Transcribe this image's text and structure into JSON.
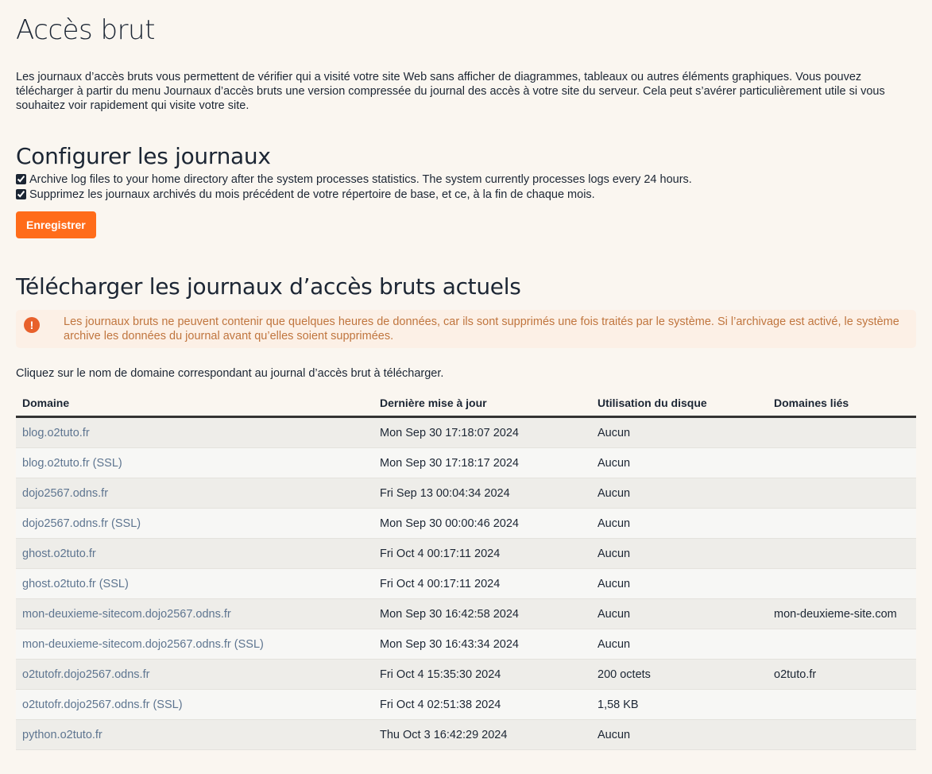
{
  "title": "Accès brut",
  "intro": "Les journaux d’accès bruts vous permettent de vérifier qui a visité votre site Web sans afficher de diagrammes, tableaux ou autres éléments graphiques. Vous pouvez télécharger à partir du menu Journaux d’accès bruts une version compressée du journal des accès à votre site du serveur. Cela peut s’avérer particulièrement utile si vous souhaitez voir rapidement qui visite votre site.",
  "config": {
    "heading": "Configurer les journaux",
    "archive_label": "Archive log files to your home directory after the system processes statistics. The system currently processes logs every 24 hours.",
    "delete_label": "Supprimez les journaux archivés du mois précédent de votre répertoire de base, et ce, à la fin de chaque mois.",
    "save_label": "Enregistrer"
  },
  "download": {
    "heading": "Télécharger les journaux d’accès bruts actuels",
    "alert": "Les journaux bruts ne peuvent contenir que quelques heures de données, car ils sont supprimés une fois traités par le système. Si l’archivage est activé, le système archive les données du journal avant qu’elles soient supprimées.",
    "hint": "Cliquez sur le nom de domaine correspondant au journal d’accès brut à télécharger.",
    "columns": [
      "Domaine",
      "Dernière mise à jour",
      "Utilisation du disque",
      "Domaines liés"
    ],
    "rows": [
      [
        "blog.o2tuto.fr",
        "Mon Sep 30 17:18:07 2024",
        "Aucun",
        ""
      ],
      [
        "blog.o2tuto.fr (SSL)",
        "Mon Sep 30 17:18:17 2024",
        "Aucun",
        ""
      ],
      [
        "dojo2567.odns.fr",
        "Fri Sep 13 00:04:34 2024",
        "Aucun",
        ""
      ],
      [
        "dojo2567.odns.fr (SSL)",
        "Mon Sep 30 00:00:46 2024",
        "Aucun",
        ""
      ],
      [
        "ghost.o2tuto.fr",
        "Fri Oct 4 00:17:11 2024",
        "Aucun",
        ""
      ],
      [
        "ghost.o2tuto.fr (SSL)",
        "Fri Oct 4 00:17:11 2024",
        "Aucun",
        ""
      ],
      [
        "mon-deuxieme-sitecom.dojo2567.odns.fr",
        "Mon Sep 30 16:42:58 2024",
        "Aucun",
        "mon-deuxieme-site.com"
      ],
      [
        "mon-deuxieme-sitecom.dojo2567.odns.fr (SSL)",
        "Mon Sep 30 16:43:34 2024",
        "Aucun",
        ""
      ],
      [
        "o2tutofr.dojo2567.odns.fr",
        "Fri Oct 4 15:35:30 2024",
        "200 octets",
        "o2tuto.fr"
      ],
      [
        "o2tutofr.dojo2567.odns.fr (SSL)",
        "Fri Oct 4 02:51:38 2024",
        "1,58 KB",
        ""
      ],
      [
        "python.o2tuto.fr",
        "Thu Oct 3 16:42:29 2024",
        "Aucun",
        ""
      ]
    ]
  }
}
